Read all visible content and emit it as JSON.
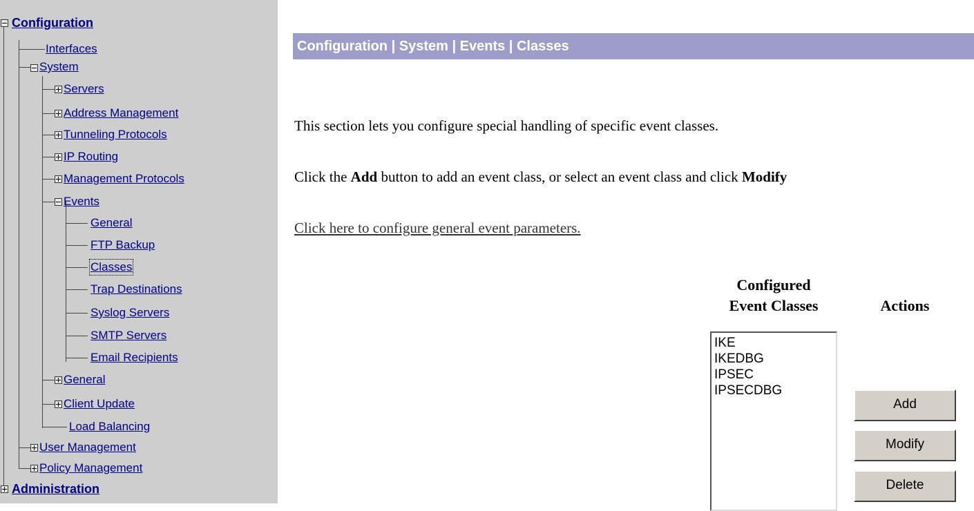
{
  "nav": {
    "configuration": "Configuration",
    "interfaces": "Interfaces",
    "system": "System",
    "servers": "Servers",
    "address_management": "Address Management",
    "tunneling_protocols": "Tunneling Protocols",
    "ip_routing": "IP Routing",
    "management_protocols": "Management Protocols",
    "events": "Events",
    "events_general": "General",
    "ftp_backup": "FTP Backup",
    "classes": "Classes",
    "trap_destinations": "Trap Destinations",
    "syslog_servers": "Syslog Servers",
    "smtp_servers": "SMTP Servers",
    "email_recipients": "Email Recipients",
    "general": "General",
    "client_update": "Client Update",
    "load_balancing": "Load Balancing",
    "user_management": "User Management",
    "policy_management": "Policy Management",
    "administration": "Administration"
  },
  "header": {
    "breadcrumb": "Configuration | System | Events | Classes"
  },
  "content": {
    "intro": "This section lets you configure special handling of specific event classes.",
    "instr_pre": "Click the ",
    "instr_add": "Add",
    "instr_mid": " button to add an event class, or select an event class and click ",
    "instr_mod": "Modify",
    "general_link": "Click here to configure general event parameters."
  },
  "classes_panel": {
    "col_header_line1": "Configured",
    "col_header_line2": "Event Classes",
    "actions_header": "Actions",
    "items": [
      "IKE",
      "IKEDBG",
      "IPSEC",
      "IPSECDBG"
    ],
    "add_label": "Add",
    "modify_label": "Modify",
    "delete_label": "Delete"
  },
  "colors": {
    "header_bg": "#9e9cc8",
    "nav_bg": "#cecece",
    "link": "#00008b"
  }
}
